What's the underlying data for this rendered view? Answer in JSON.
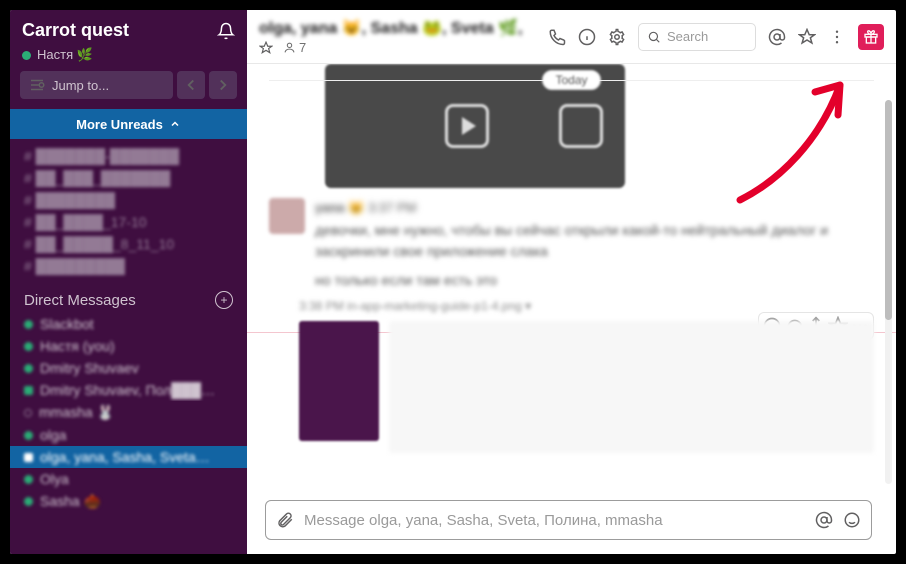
{
  "workspace": {
    "name": "Carrot quest",
    "presence": "Настя 🌿"
  },
  "jump": {
    "placeholder": "Jump to..."
  },
  "unreads": {
    "label": "More Unreads"
  },
  "channels": [
    "# ███████-███████",
    "# ██_███_███████",
    "# ████████",
    "# ██_████_17-10",
    "# ██_█████_8_11_10",
    "# █████████"
  ],
  "section_dm": "Direct Messages",
  "dms": [
    {
      "label": "Slackbot",
      "dot": "online",
      "blur": true
    },
    {
      "label": "Настя  (you)",
      "dot": "online",
      "blur": true
    },
    {
      "label": "Dmitry Shuvaev",
      "dot": "online",
      "blur": true
    },
    {
      "label": "Dmitry Shuvaev, Пол███…",
      "dot": "sq",
      "blur": true
    },
    {
      "label": "mmasha 🐰",
      "dot": "away",
      "blur": true
    },
    {
      "label": "olga",
      "dot": "online",
      "blur": true
    },
    {
      "label": "olga, yana, Sasha, Sveta…",
      "dot": "sq",
      "active": true,
      "blur": true
    },
    {
      "label": "Olya",
      "dot": "online",
      "blur": true
    },
    {
      "label": "Sasha 🌰",
      "dot": "online",
      "blur": true
    }
  ],
  "header": {
    "title": "olga, yana 😺, Sasha 🐸, Sveta 🌿,",
    "members": "7",
    "search_placeholder": "Search"
  },
  "divider": {
    "today": "Today"
  },
  "message": {
    "author": "yana 😺",
    "time": "3:37 PM",
    "line1": "девочки, мне нужно, чтобы вы сейчас открыли какой-то нейтральный диалог и",
    "line2": "заскринили свое приложение слака",
    "line3": "но только если там есть это"
  },
  "attachment": {
    "meta": "3:38 PM   in-app-marketing-guide-p1-4.png ▾"
  },
  "composer": {
    "placeholder": "Message olga, yana, Sasha, Sveta, Полина, mmasha"
  }
}
